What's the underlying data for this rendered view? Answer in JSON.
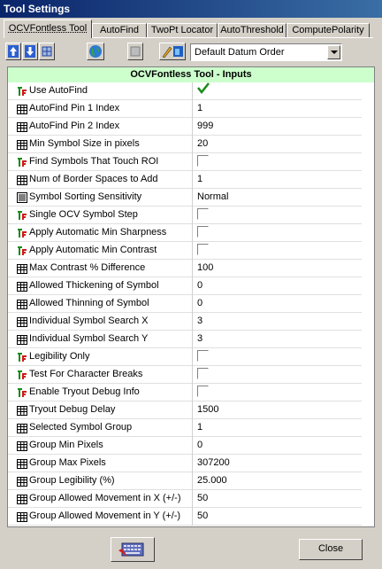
{
  "window": {
    "title": "Tool Settings"
  },
  "tabs": [
    {
      "label": "OCVFontless Tool",
      "active": true
    },
    {
      "label": "AutoFind"
    },
    {
      "label": "TwoPt Locator"
    },
    {
      "label": "AutoThreshold"
    },
    {
      "label": "ComputePolarity"
    }
  ],
  "toolbar": {
    "datum_select": "Default Datum Order"
  },
  "grid": {
    "header": "OCVFontless Tool - Inputs",
    "rows": [
      {
        "icon": "tf-icon",
        "label": "Use AutoFind",
        "type": "check",
        "checked": true
      },
      {
        "icon": "numeric-icon",
        "label": "AutoFind Pin 1 Index",
        "type": "text",
        "value": "1"
      },
      {
        "icon": "numeric-icon",
        "label": "AutoFind Pin 2 Index",
        "type": "text",
        "value": "999"
      },
      {
        "icon": "numeric-icon",
        "label": "Min Symbol Size in pixels",
        "type": "text",
        "value": "20"
      },
      {
        "icon": "tf-icon",
        "label": "Find Symbols That Touch ROI",
        "type": "check",
        "checked": false
      },
      {
        "icon": "numeric-icon",
        "label": "Num of Border Spaces to Add",
        "type": "text",
        "value": "1"
      },
      {
        "icon": "list-icon",
        "label": "Symbol Sorting Sensitivity",
        "type": "text",
        "value": "Normal"
      },
      {
        "icon": "tf-icon",
        "label": "Single OCV Symbol Step",
        "type": "check",
        "checked": false
      },
      {
        "icon": "tf-icon",
        "label": "Apply Automatic Min Sharpness",
        "type": "check",
        "checked": false
      },
      {
        "icon": "tf-icon",
        "label": "Apply Automatic Min Contrast",
        "type": "check",
        "checked": false
      },
      {
        "icon": "numeric-icon",
        "label": "Max Contrast % Difference",
        "type": "text",
        "value": "100"
      },
      {
        "icon": "numeric-icon",
        "label": "Allowed Thickening of Symbol",
        "type": "text",
        "value": "0"
      },
      {
        "icon": "numeric-icon",
        "label": "Allowed Thinning of Symbol",
        "type": "text",
        "value": "0"
      },
      {
        "icon": "numeric-icon",
        "label": "Individual Symbol Search X",
        "type": "text",
        "value": "3"
      },
      {
        "icon": "numeric-icon",
        "label": "Individual Symbol Search Y",
        "type": "text",
        "value": "3"
      },
      {
        "icon": "tf-icon",
        "label": "Legibility Only",
        "type": "check",
        "checked": false
      },
      {
        "icon": "tf-icon",
        "label": "Test For Character Breaks",
        "type": "check",
        "checked": false
      },
      {
        "icon": "tf-icon",
        "label": "Enable Tryout Debug Info",
        "type": "check",
        "checked": false
      },
      {
        "icon": "numeric-icon",
        "label": "Tryout Debug Delay",
        "type": "text",
        "value": "1500"
      },
      {
        "icon": "numeric-icon",
        "label": "Selected Symbol Group",
        "type": "text",
        "value": "1"
      },
      {
        "icon": "numeric-icon",
        "label": "Group Min Pixels",
        "type": "text",
        "value": "0"
      },
      {
        "icon": "numeric-icon",
        "label": "Group Max Pixels",
        "type": "text",
        "value": "307200"
      },
      {
        "icon": "numeric-icon",
        "label": "Group Legibility (%)",
        "type": "text",
        "value": "25.000"
      },
      {
        "icon": "numeric-icon",
        "label": "Group Allowed Movement in X (+/-)",
        "type": "text",
        "value": "50"
      },
      {
        "icon": "numeric-icon",
        "label": "Group Allowed Movement in Y (+/-)",
        "type": "text",
        "value": "50"
      }
    ]
  },
  "footer": {
    "close_label": "Close"
  }
}
